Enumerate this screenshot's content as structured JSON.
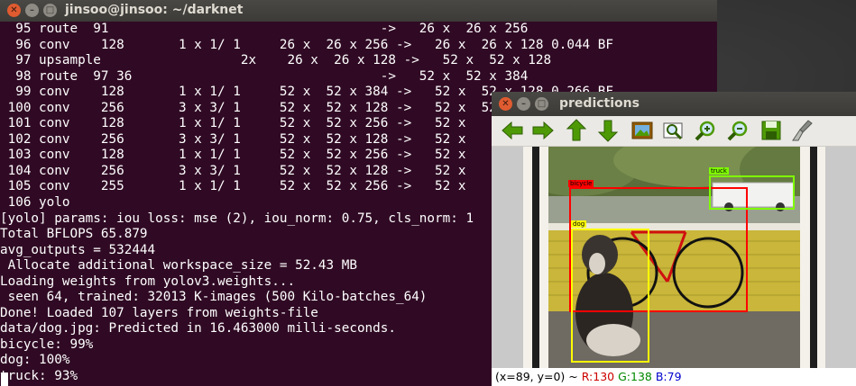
{
  "terminal": {
    "title": "jinsoo@jinsoo: ~/darknet",
    "lines": [
      "  95 route  91                                   ->   26 x  26 x 256",
      "  96 conv    128       1 x 1/ 1     26 x  26 x 256 ->   26 x  26 x 128 0.044 BF",
      "  97 upsample                  2x    26 x  26 x 128 ->   52 x  52 x 128",
      "  98 route  97 36                                ->   52 x  52 x 384",
      "  99 conv    128       1 x 1/ 1     52 x  52 x 384 ->   52 x  52 x 128 0.266 BF",
      " 100 conv    256       3 x 3/ 1     52 x  52 x 128 ->   52 x  52 x 256",
      " 101 conv    128       1 x 1/ 1     52 x  52 x 256 ->   52 x",
      " 102 conv    256       3 x 3/ 1     52 x  52 x 128 ->   52 x",
      " 103 conv    128       1 x 1/ 1     52 x  52 x 256 ->   52 x",
      " 104 conv    256       3 x 3/ 1     52 x  52 x 128 ->   52 x",
      " 105 conv    255       1 x 1/ 1     52 x  52 x 256 ->   52 x",
      " 106 yolo",
      "[yolo] params: iou loss: mse (2), iou_norm: 0.75, cls_norm: 1",
      "Total BFLOPS 65.879",
      "avg_outputs = 532444",
      " Allocate additional workspace_size = 52.43 MB",
      "Loading weights from yolov3.weights...",
      " seen 64, trained: 32013 K-images (500 Kilo-batches_64)",
      "Done! Loaded 107 layers from weights-file",
      "data/dog.jpg: Predicted in 16.463000 milli-seconds.",
      "bicycle: 99%",
      "dog: 100%",
      "truck: 93%"
    ]
  },
  "predictions": {
    "title": "predictions",
    "toolbar": [
      {
        "icon": "arrow-left-icon",
        "color": "#4e9a06"
      },
      {
        "icon": "arrow-right-icon",
        "color": "#4e9a06"
      },
      {
        "icon": "arrow-up-icon",
        "color": "#4e9a06"
      },
      {
        "icon": "arrow-down-icon",
        "color": "#4e9a06"
      },
      {
        "icon": "image-icon",
        "color": "#8f5902"
      },
      {
        "icon": "zoom-fit-icon",
        "color": "#4e9a06"
      },
      {
        "icon": "zoom-in-icon",
        "color": "#4e9a06"
      },
      {
        "icon": "zoom-out-icon",
        "color": "#4e9a06"
      },
      {
        "icon": "save-icon",
        "color": "#4e9a06"
      },
      {
        "icon": "brush-icon",
        "color": "#888a85"
      }
    ],
    "detections": [
      {
        "label": "bicycle",
        "color": "#ff0000"
      },
      {
        "label": "truck",
        "color": "#7fff00"
      },
      {
        "label": "dog",
        "color": "#ffff00"
      }
    ],
    "status": {
      "coords": "(x=89, y=0) ~",
      "r": "R:130",
      "g": "G:138",
      "b": "B:79"
    }
  }
}
